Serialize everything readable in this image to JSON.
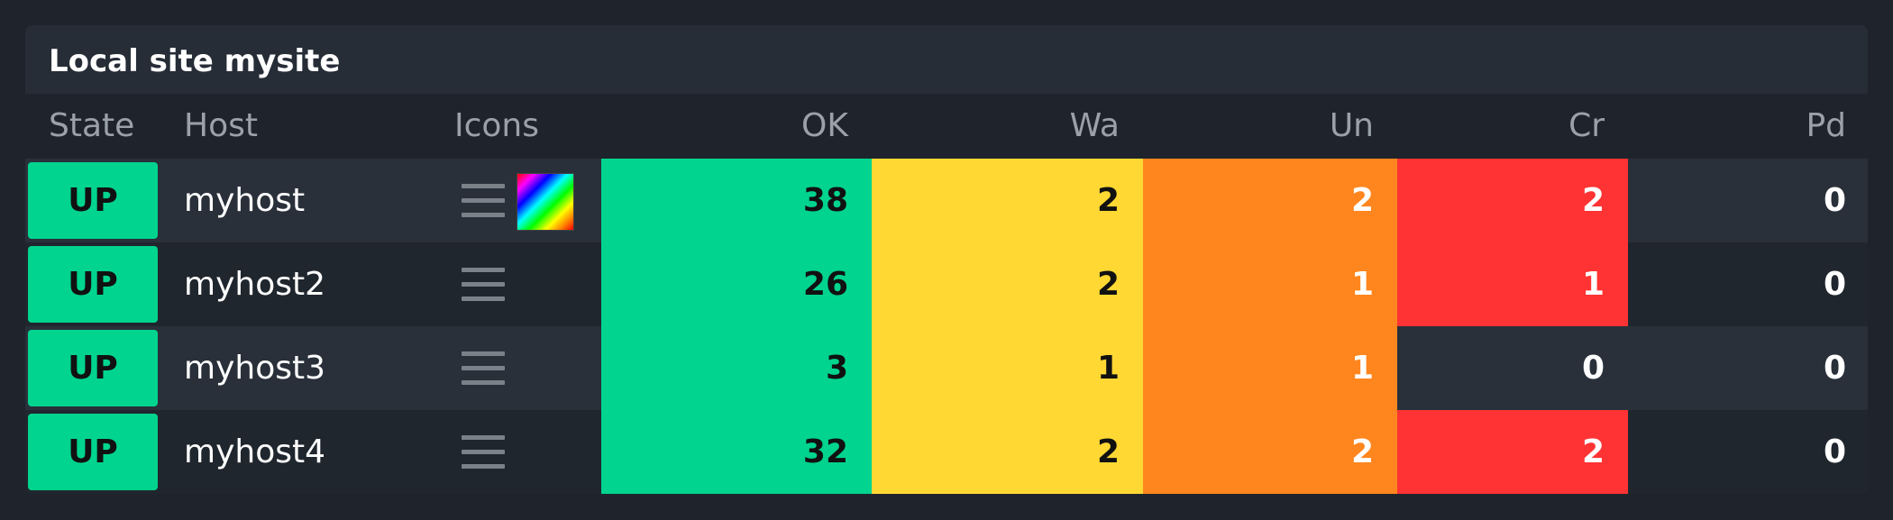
{
  "dashlet": {
    "title": "Local site mysite"
  },
  "columns": {
    "state": "State",
    "host": "Host",
    "icons": "Icons",
    "ok": "OK",
    "wa": "Wa",
    "un": "Un",
    "cr": "Cr",
    "pd": "Pd"
  },
  "colors": {
    "up": "#00d48e",
    "ok": "#00d48e",
    "warn": "#ffd833",
    "unknown": "#ff861f",
    "crit": "#ff3333"
  },
  "rows": [
    {
      "state": "UP",
      "host": "myhost",
      "icons": [
        "menu-icon",
        "rainbow-icon"
      ],
      "ok": "38",
      "wa": "2",
      "un": "2",
      "cr": "2",
      "pd": "0"
    },
    {
      "state": "UP",
      "host": "myhost2",
      "icons": [
        "menu-icon"
      ],
      "ok": "26",
      "wa": "2",
      "un": "1",
      "cr": "1",
      "pd": "0"
    },
    {
      "state": "UP",
      "host": "myhost3",
      "icons": [
        "menu-icon"
      ],
      "ok": "3",
      "wa": "1",
      "un": "1",
      "cr": "0",
      "pd": "0"
    },
    {
      "state": "UP",
      "host": "myhost4",
      "icons": [
        "menu-icon"
      ],
      "ok": "32",
      "wa": "2",
      "un": "2",
      "cr": "2",
      "pd": "0"
    }
  ]
}
